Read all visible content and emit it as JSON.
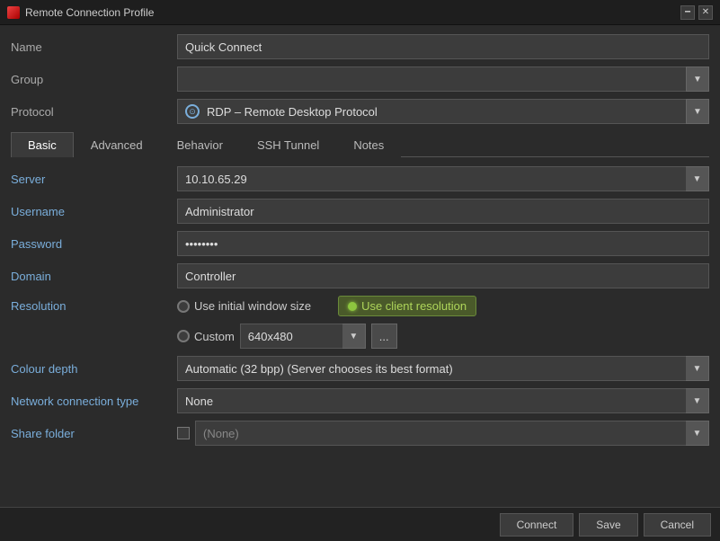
{
  "titleBar": {
    "title": "Remote Connection Profile",
    "minimize": "🗕",
    "close": "✕"
  },
  "form": {
    "name_label": "Name",
    "name_value": "Quick Connect",
    "group_label": "Group",
    "group_value": "",
    "protocol_label": "Protocol",
    "protocol_value": "RDP – Remote Desktop Protocol"
  },
  "tabs": [
    {
      "label": "Basic",
      "active": true
    },
    {
      "label": "Advanced",
      "active": false
    },
    {
      "label": "Behavior",
      "active": false
    },
    {
      "label": "SSH Tunnel",
      "active": false
    },
    {
      "label": "Notes",
      "active": false
    }
  ],
  "basic": {
    "server_label": "Server",
    "server_value": "10.10.65.29",
    "username_label": "Username",
    "username_value": "Administrator",
    "password_label": "Password",
    "password_value": "●●●●●●●",
    "domain_label": "Domain",
    "domain_value": "Controller",
    "resolution_label": "Resolution",
    "resolution_option1": "Use initial window size",
    "resolution_option2": "Use client resolution",
    "resolution_custom_label": "Custom",
    "resolution_custom_value": "640x480",
    "dots_btn": "...",
    "colour_depth_label": "Colour depth",
    "colour_depth_value": "Automatic (32 bpp) (Server chooses its best format)",
    "network_label": "Network connection type",
    "network_value": "None",
    "share_folder_label": "Share folder",
    "share_folder_value": "(None)"
  },
  "bottomButtons": [
    {
      "label": "Connect",
      "name": "connect-button"
    },
    {
      "label": "Save",
      "name": "save-button"
    },
    {
      "label": "Cancel",
      "name": "cancel-button"
    }
  ]
}
